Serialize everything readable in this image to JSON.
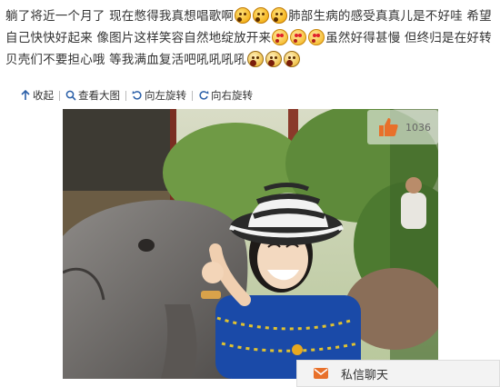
{
  "post": {
    "segment1": "躺了将近一个月了 现在憋得我真想唱歌啊",
    "segment2": "肺部生病的感受真真儿是不好哇 希望自己快快好起来 像图片这样笑容自然地绽放开来",
    "segment3": "虽然好得甚慢 但终归是在好转 贝壳们不要担心哦 等我满血复活吧吼吼吼吼",
    "emoji_sad": "sad-face-emoji",
    "emoji_smile": "smile-face-emoji",
    "emoji_roar": "roar-face-emoji"
  },
  "toolbar": {
    "collapse": "收起",
    "view_large": "查看大图",
    "rotate_left": "向左旋转",
    "rotate_right": "向右旋转"
  },
  "photo": {
    "like_count": "1036"
  },
  "chat": {
    "label": "私信聊天"
  },
  "colors": {
    "text": "#333333",
    "like_icon": "#e8702a",
    "chat_icon": "#e8702a"
  }
}
